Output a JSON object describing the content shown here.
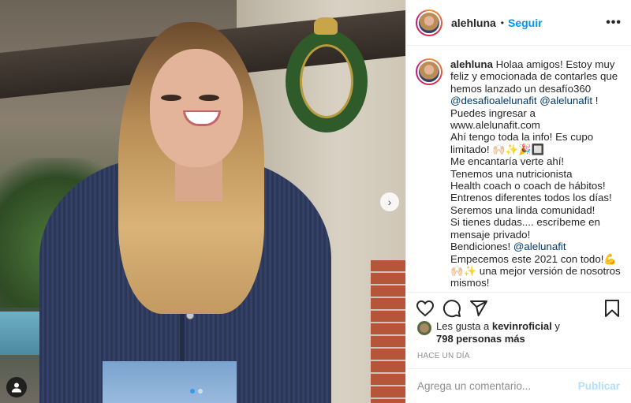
{
  "post": {
    "username": "alehluna",
    "bullet": "•",
    "follow_label": "Seguir",
    "more_label": "•••",
    "next_arrow": "›",
    "carousel": {
      "count": 2,
      "active": 0
    }
  },
  "caption": {
    "username": "alehluna",
    "lines": [
      "Holaa amigos! Estoy muy feliz y emocionada de contarles que hemos lanzado un desafío360",
      "@desafioalelunafit @alelunafit",
      "!",
      "Puedes ingresar a",
      "www.alelunafit.com",
      "Ahí tengo toda la info! Es cupo limitado! 🙌🏻✨🎉🔲",
      "Me encantaría verte ahí!",
      "Tenemos una nutricionista",
      "Health coach o coach de hábitos!",
      "Entrenos diferentes todos los días!",
      "Seremos una linda comunidad!",
      "Si tienes dudas.... escríbeme en mensaje privado!",
      "Bendiciones!",
      "@alelunafit",
      "Empecemos este 2021 con todo!💪",
      "🙌🏻✨ una mejor versión de nosotros mismos!"
    ]
  },
  "likes": {
    "prefix": "Les gusta a",
    "user": "kevinroficial",
    "conj": "y",
    "others": "798 personas más"
  },
  "timestamp": "HACE UN DÍA",
  "comment": {
    "placeholder": "Agrega un comentario...",
    "post_label": "Publicar"
  },
  "colors": {
    "follow": "#0095f6",
    "mention": "#00376b",
    "post_disabled": "#b2dffc",
    "muted": "#8e8e8e"
  }
}
